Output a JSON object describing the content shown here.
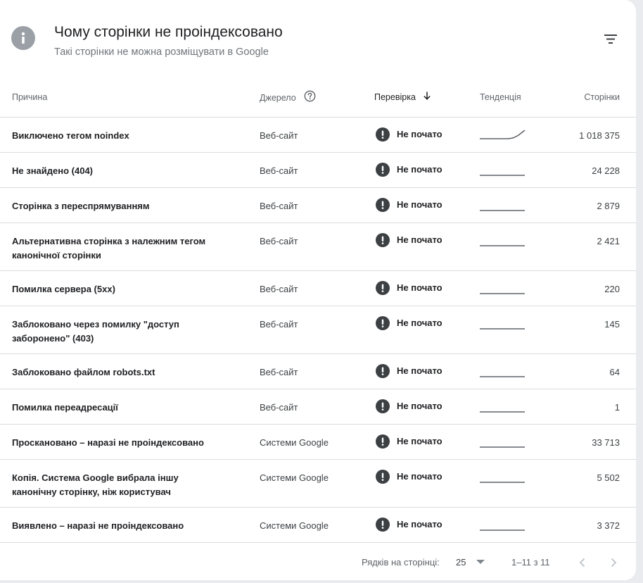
{
  "header": {
    "title": "Чому сторінки не проіндексовано",
    "subtitle": "Такі сторінки не можна розміщувати в Google",
    "info_icon": "info-icon",
    "filter_icon": "filter-icon"
  },
  "columns": {
    "reason": "Причина",
    "source": "Джерело",
    "check": "Перевірка",
    "trend": "Тенденція",
    "pages": "Сторінки"
  },
  "rows": [
    {
      "reason": "Виключено тегом noindex",
      "source": "Веб-сайт",
      "status": "Не почато",
      "pages": "1 018 375",
      "trend_type": "rising"
    },
    {
      "reason": "Не знайдено (404)",
      "source": "Веб-сайт",
      "status": "Не почато",
      "pages": "24 228",
      "trend_type": "flat"
    },
    {
      "reason": "Сторінка з переспрямуванням",
      "source": "Веб-сайт",
      "status": "Не почато",
      "pages": "2 879",
      "trend_type": "flat"
    },
    {
      "reason": "Альтернативна сторінка з належним тегом канонічної сторінки",
      "source": "Веб-сайт",
      "status": "Не почато",
      "pages": "2 421",
      "trend_type": "flat"
    },
    {
      "reason": "Помилка сервера (5xx)",
      "source": "Веб-сайт",
      "status": "Не почато",
      "pages": "220",
      "trend_type": "flat"
    },
    {
      "reason": "Заблоковано через помилку \"доступ заборонено\" (403)",
      "source": "Веб-сайт",
      "status": "Не почато",
      "pages": "145",
      "trend_type": "flat"
    },
    {
      "reason": "Заблоковано файлом robots.txt",
      "source": "Веб-сайт",
      "status": "Не почато",
      "pages": "64",
      "trend_type": "flat"
    },
    {
      "reason": "Помилка переадресації",
      "source": "Веб-сайт",
      "status": "Не почато",
      "pages": "1",
      "trend_type": "flat"
    },
    {
      "reason": "Проскановано – наразі не проіндексовано",
      "source": "Системи Google",
      "status": "Не почато",
      "pages": "33 713",
      "trend_type": "flat"
    },
    {
      "reason": "Копія. Система Google вибрала іншу канонічну сторінку, ніж користувач",
      "source": "Системи Google",
      "status": "Не почато",
      "pages": "5 502",
      "trend_type": "flat"
    },
    {
      "reason": "Виявлено – наразі не проіндексовано",
      "source": "Системи Google",
      "status": "Не почато",
      "pages": "3 372",
      "trend_type": "flat"
    }
  ],
  "footer": {
    "rows_per_page_label": "Рядків на сторінці:",
    "rows_per_page_value": "25",
    "range": "1–11 з 11"
  },
  "colors": {
    "status_icon": "#3c4043",
    "trend_line": "#5f6368",
    "divider": "#dadce0"
  }
}
